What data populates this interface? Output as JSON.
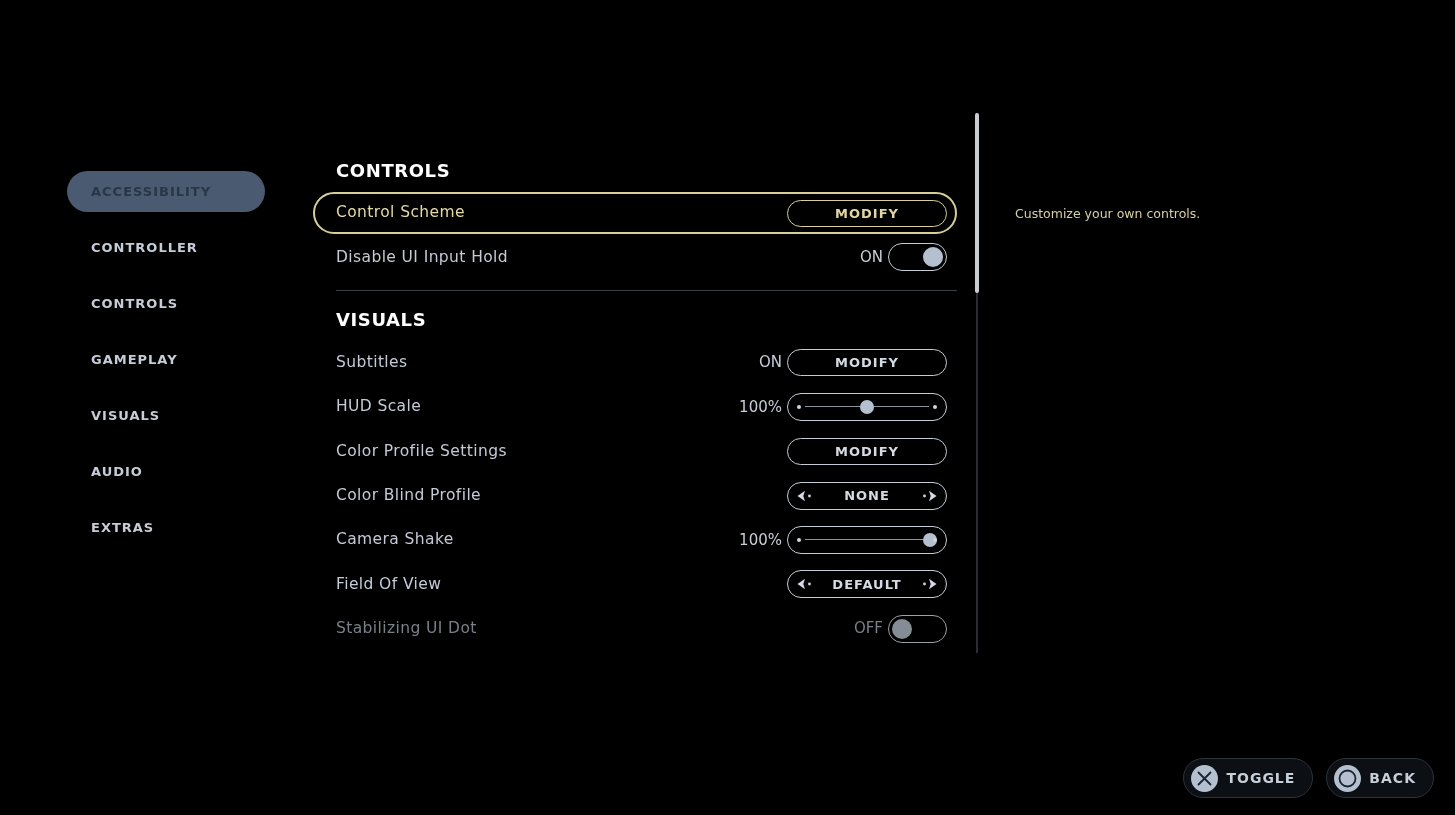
{
  "sidebar": {
    "items": [
      {
        "label": "ACCESSIBILITY",
        "selected": true
      },
      {
        "label": "CONTROLLER",
        "selected": false
      },
      {
        "label": "CONTROLS",
        "selected": false
      },
      {
        "label": "GAMEPLAY",
        "selected": false
      },
      {
        "label": "VISUALS",
        "selected": false
      },
      {
        "label": "AUDIO",
        "selected": false
      },
      {
        "label": "EXTRAS",
        "selected": false
      }
    ]
  },
  "sections": [
    {
      "title": "CONTROLS",
      "rows": [
        {
          "kind": "button",
          "label": "Control Scheme",
          "selected": true,
          "disabled": false,
          "button": "MODIFY"
        },
        {
          "kind": "toggle",
          "label": "Disable UI Input Hold",
          "selected": false,
          "disabled": false,
          "reading": "ON",
          "on": true
        }
      ]
    },
    {
      "title": "VISUALS",
      "rows": [
        {
          "kind": "button",
          "label": "Subtitles",
          "selected": false,
          "disabled": false,
          "reading": "ON",
          "button": "MODIFY"
        },
        {
          "kind": "slider",
          "label": "HUD Scale",
          "selected": false,
          "disabled": false,
          "reading": "100%",
          "level": 0.5
        },
        {
          "kind": "button",
          "label": "Color Profile Settings",
          "selected": false,
          "disabled": false,
          "button": "MODIFY"
        },
        {
          "kind": "selector",
          "label": "Color Blind Profile",
          "selected": false,
          "disabled": false,
          "value": "NONE"
        },
        {
          "kind": "slider",
          "label": "Camera Shake",
          "selected": false,
          "disabled": false,
          "reading": "100%",
          "level": 1
        },
        {
          "kind": "selector",
          "label": "Field Of View",
          "selected": false,
          "disabled": false,
          "value": "DEFAULT"
        },
        {
          "kind": "toggle",
          "label": "Stabilizing UI Dot",
          "selected": false,
          "disabled": true,
          "reading": "OFF",
          "on": false
        }
      ]
    }
  ],
  "description": "Customize your own controls.",
  "footer_buttons": [
    {
      "kind": "cross",
      "label": "TOGGLE"
    },
    {
      "kind": "circle",
      "label": "BACK"
    }
  ]
}
